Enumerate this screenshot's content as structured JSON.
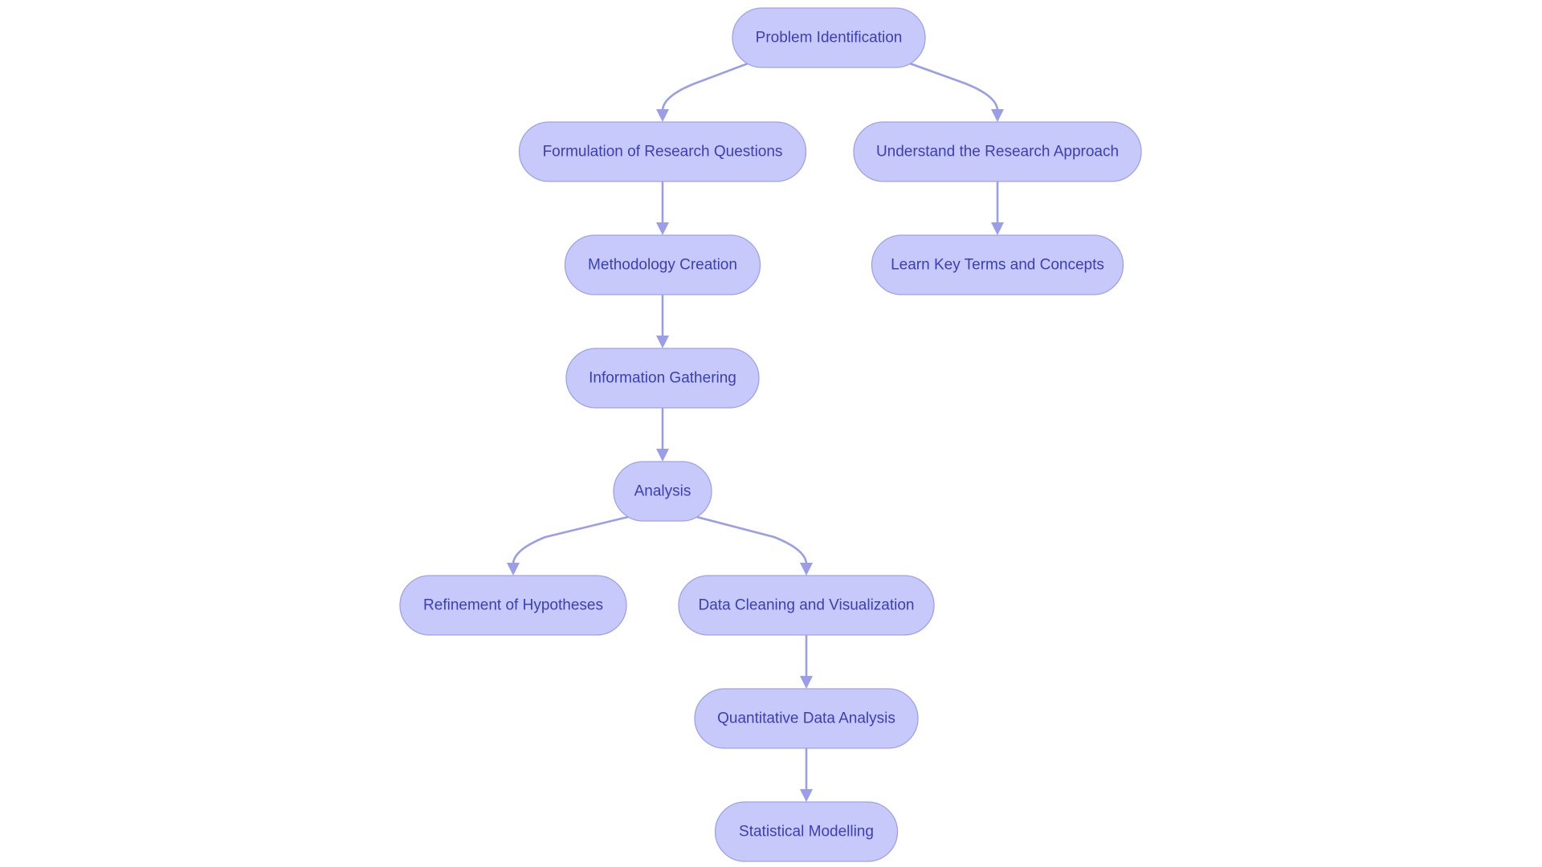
{
  "diagram": {
    "type": "flowchart",
    "direction": "top-down",
    "colors": {
      "node_fill": "#c8c9fb",
      "node_stroke": "#9ea1e9",
      "edge": "#9a9ee8",
      "text": "#3a3eb8",
      "background": "#ffffff"
    },
    "nodes": [
      {
        "id": "problem",
        "label": "Problem Identification"
      },
      {
        "id": "formulation",
        "label": "Formulation of Research Questions"
      },
      {
        "id": "understand",
        "label": "Understand the Research Approach"
      },
      {
        "id": "methodology",
        "label": "Methodology Creation"
      },
      {
        "id": "learn",
        "label": "Learn Key Terms and Concepts"
      },
      {
        "id": "information",
        "label": "Information Gathering"
      },
      {
        "id": "analysis",
        "label": "Analysis"
      },
      {
        "id": "refinement",
        "label": "Refinement of Hypotheses"
      },
      {
        "id": "cleaning",
        "label": "Data Cleaning and Visualization"
      },
      {
        "id": "quantitative",
        "label": "Quantitative Data Analysis"
      },
      {
        "id": "statistical",
        "label": "Statistical Modelling"
      }
    ],
    "edges": [
      {
        "from": "problem",
        "to": "formulation"
      },
      {
        "from": "problem",
        "to": "understand"
      },
      {
        "from": "formulation",
        "to": "methodology"
      },
      {
        "from": "understand",
        "to": "learn"
      },
      {
        "from": "methodology",
        "to": "information"
      },
      {
        "from": "information",
        "to": "analysis"
      },
      {
        "from": "analysis",
        "to": "refinement"
      },
      {
        "from": "analysis",
        "to": "cleaning"
      },
      {
        "from": "cleaning",
        "to": "quantitative"
      },
      {
        "from": "quantitative",
        "to": "statistical"
      }
    ]
  }
}
